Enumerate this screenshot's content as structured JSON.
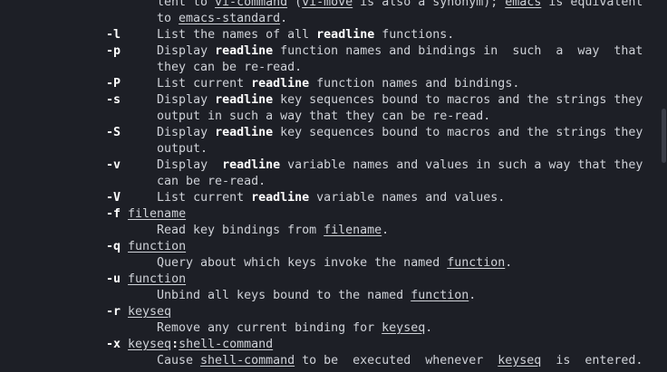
{
  "window": {
    "accent": "#cfd2d8",
    "background": "#1d1f26"
  },
  "lines": [
    [
      {
        "t": "lent to "
      },
      {
        "t": "vi-command",
        "s": "u"
      },
      {
        "t": " ("
      },
      {
        "t": "vi-move",
        "s": "u"
      },
      {
        "t": " is also a synonym); "
      },
      {
        "t": "emacs",
        "s": "u"
      },
      {
        "t": " is equivalent"
      }
    ],
    [
      {
        "t": "to "
      },
      {
        "t": "emacs-standard",
        "s": "u"
      },
      {
        "t": "."
      }
    ],
    [
      {
        "t": "-l",
        "s": "b"
      },
      {
        "t": "     List the names of all "
      },
      {
        "t": "readline",
        "s": "b"
      },
      {
        "t": " functions."
      }
    ],
    [
      {
        "t": "-p",
        "s": "b"
      },
      {
        "t": "     Display "
      },
      {
        "t": "readline",
        "s": "b"
      },
      {
        "t": " function names and bindings in  such  a  way  that"
      }
    ],
    [
      {
        "t": "they can be re-read."
      }
    ],
    [
      {
        "t": "-P",
        "s": "b"
      },
      {
        "t": "     List current "
      },
      {
        "t": "readline",
        "s": "b"
      },
      {
        "t": " function names and bindings."
      }
    ],
    [
      {
        "t": "-s",
        "s": "b"
      },
      {
        "t": "     Display "
      },
      {
        "t": "readline",
        "s": "b"
      },
      {
        "t": " key sequences bound to macros and the strings they"
      }
    ],
    [
      {
        "t": "output in such a way that they can be re-read."
      }
    ],
    [
      {
        "t": "-S",
        "s": "b"
      },
      {
        "t": "     Display "
      },
      {
        "t": "readline",
        "s": "b"
      },
      {
        "t": " key sequences bound to macros and the strings they"
      }
    ],
    [
      {
        "t": "output."
      }
    ],
    [
      {
        "t": "-v",
        "s": "b"
      },
      {
        "t": "     Display  "
      },
      {
        "t": "readline",
        "s": "b"
      },
      {
        "t": " variable names and values in such a way that they"
      }
    ],
    [
      {
        "t": "can be re-read."
      }
    ],
    [
      {
        "t": "-V",
        "s": "b"
      },
      {
        "t": "     List current "
      },
      {
        "t": "readline",
        "s": "b"
      },
      {
        "t": " variable names and values."
      }
    ],
    [
      {
        "t": "-f",
        "s": "b"
      },
      {
        "t": " "
      },
      {
        "t": "filename",
        "s": "u"
      }
    ],
    [
      {
        "t": "Read key bindings from "
      },
      {
        "t": "filename",
        "s": "u"
      },
      {
        "t": "."
      }
    ],
    [
      {
        "t": "-q",
        "s": "b"
      },
      {
        "t": " "
      },
      {
        "t": "function",
        "s": "u"
      }
    ],
    [
      {
        "t": "Query about which keys invoke the named "
      },
      {
        "t": "function",
        "s": "u"
      },
      {
        "t": "."
      }
    ],
    [
      {
        "t": "-u",
        "s": "b"
      },
      {
        "t": " "
      },
      {
        "t": "function",
        "s": "u"
      }
    ],
    [
      {
        "t": "Unbind all keys bound to the named "
      },
      {
        "t": "function",
        "s": "u"
      },
      {
        "t": "."
      }
    ],
    [
      {
        "t": "-r",
        "s": "b"
      },
      {
        "t": " "
      },
      {
        "t": "keyseq",
        "s": "u"
      }
    ],
    [
      {
        "t": "Remove any current binding for "
      },
      {
        "t": "keyseq",
        "s": "u"
      },
      {
        "t": "."
      }
    ],
    [
      {
        "t": "-x",
        "s": "b"
      },
      {
        "t": " "
      },
      {
        "t": "keyseq",
        "s": "u"
      },
      {
        "t": ":",
        "s": "b"
      },
      {
        "t": "shell-command",
        "s": "u"
      }
    ],
    [
      {
        "t": "Cause "
      },
      {
        "t": "shell-command",
        "s": "u"
      },
      {
        "t": " to be  executed  whenever  "
      },
      {
        "t": "keyseq",
        "s": "u"
      },
      {
        "t": "  is  entered."
      }
    ]
  ]
}
